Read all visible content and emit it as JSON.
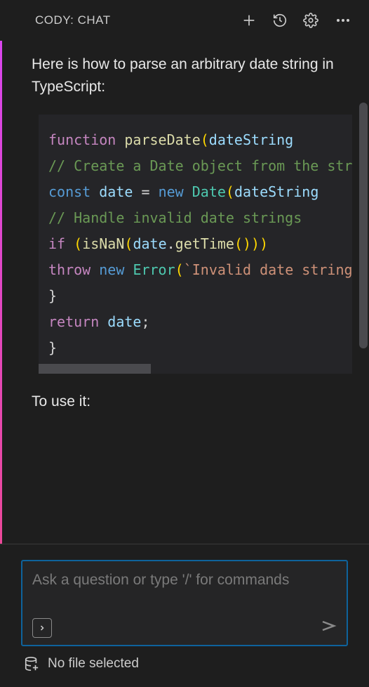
{
  "header": {
    "title": "CODY: CHAT"
  },
  "chat": {
    "intro": "Here is how to parse an arbitrary date string in TypeScript:",
    "usage": "To use it:",
    "code": {
      "l1_kw": "function",
      "l1_fn": "parseDate",
      "l1_param": "dateString",
      "l2_comment": "// Create a Date object from the string",
      "l3_const": "const",
      "l3_var": "date",
      "l3_eq": "=",
      "l3_new": "new",
      "l3_type": "Date",
      "l3_arg": "dateString",
      "l5_comment": "// Handle invalid date strings",
      "l6_if": "if",
      "l6_isnan": "isNaN",
      "l6_date": "date",
      "l6_get": "getTime",
      "l7_throw": "throw",
      "l7_new": "new",
      "l7_err": "Error",
      "l7_str": "`Invalid date string`",
      "l8_brace": "}",
      "l10_return": "return",
      "l10_var": "date",
      "l11_brace": "}"
    }
  },
  "input": {
    "placeholder": "Ask a question or type '/' for commands"
  },
  "status": {
    "file": "No file selected"
  }
}
